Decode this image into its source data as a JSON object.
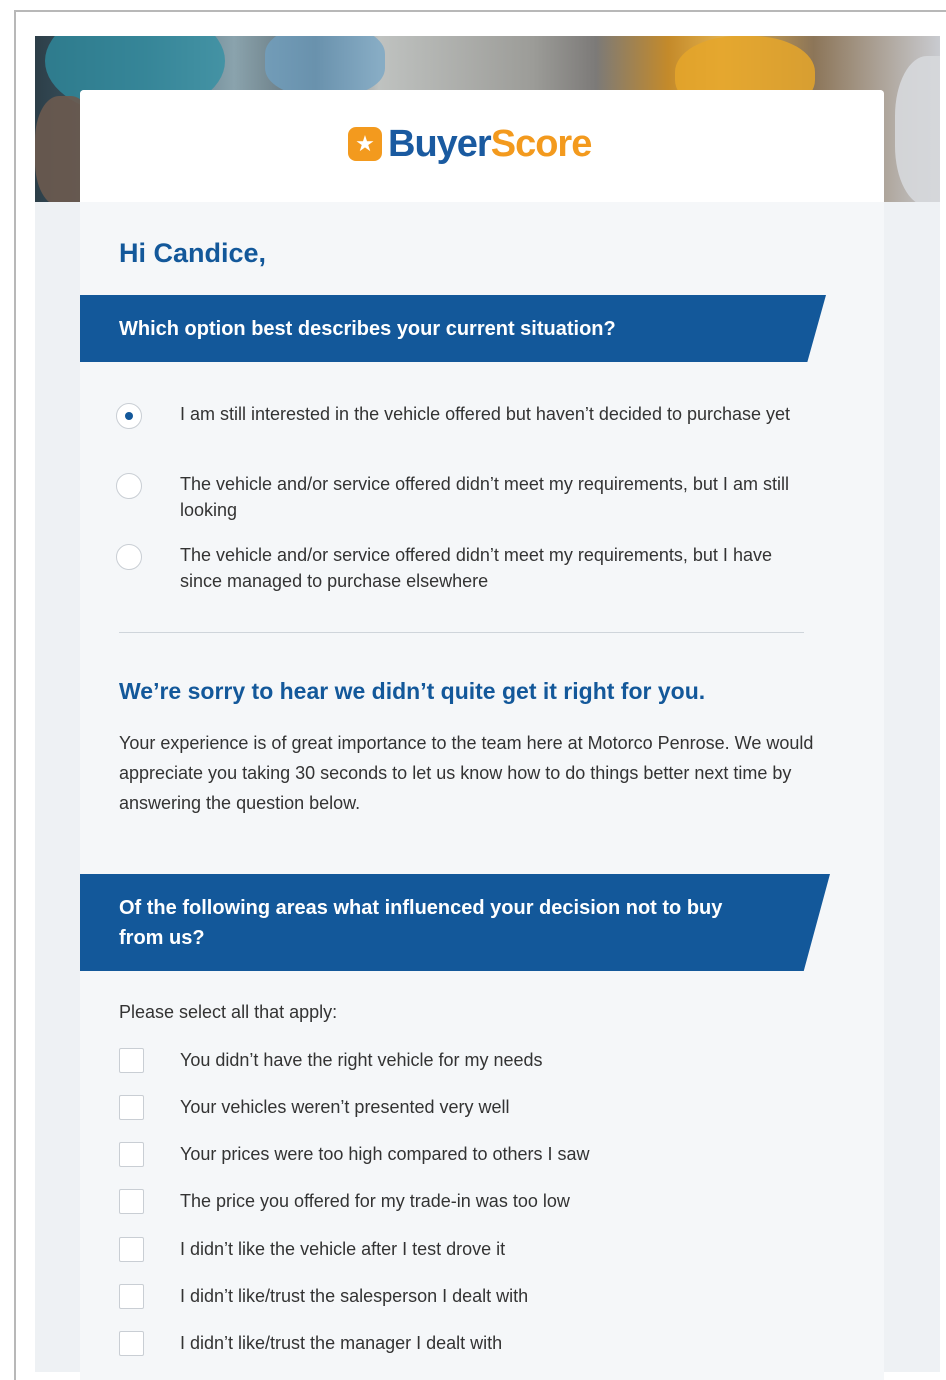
{
  "brand": {
    "name_part1": "Buyer",
    "name_part2": "Score",
    "logo_icon": "star-icon",
    "primary_color": "#13589a",
    "accent_color": "#f39a1e"
  },
  "greeting": "Hi Candice,",
  "situation": {
    "question": "Which option best describes your current situation?",
    "options": [
      {
        "label": "I am still interested in the vehicle offered but haven’t decided to purchase yet",
        "selected": true
      },
      {
        "label": "The vehicle and/or service offered didn’t meet my requirements, but I am still looking",
        "selected": false
      },
      {
        "label": "The vehicle and/or service offered didn’t meet my requirements, but I have since managed to purchase elsewhere",
        "selected": false
      }
    ]
  },
  "sorry_heading": "We’re sorry to hear we didn’t quite get it right for you.",
  "sorry_text": "Your experience is of great importance to the team here at Motorco Penrose. We would appreciate you taking 30 seconds to let us know how to do things better next time by answering the question below.",
  "influence": {
    "question": "Of the following areas what influenced your decision not to buy from us?",
    "instruction": "Please select all that apply:",
    "options": [
      {
        "label": "You didn’t have the right vehicle for my needs",
        "checked": false
      },
      {
        "label": "Your vehicles weren’t presented very well",
        "checked": false
      },
      {
        "label": "Your prices were too high compared to others I saw",
        "checked": false
      },
      {
        "label": "The price you offered for my trade-in was too low",
        "checked": false
      },
      {
        "label": "I didn’t like the vehicle after I test drove it",
        "checked": false
      },
      {
        "label": "I didn’t like/trust the salesperson I dealt with",
        "checked": false
      },
      {
        "label": "I didn’t like/trust the manager I dealt with",
        "checked": false
      }
    ]
  }
}
